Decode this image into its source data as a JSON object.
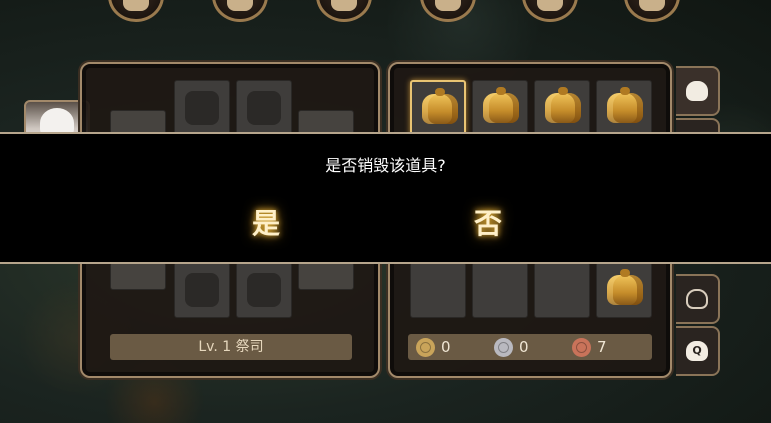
{
  "top_nav": {
    "items": [
      {
        "icon": "scroll-icon"
      },
      {
        "icon": "bag-icon"
      },
      {
        "icon": "crossed-swords-icon"
      },
      {
        "icon": "chest-icon"
      },
      {
        "icon": "map-icon"
      },
      {
        "icon": "gear-icon"
      }
    ]
  },
  "character": {
    "level_label": "Lv. 1 祭司",
    "equipment_slots": [
      {
        "icon": "helmet-icon"
      },
      {
        "icon": "amulet-icon"
      },
      {
        "icon": "gauntlet-icon"
      },
      {
        "icon": "boots-icon"
      }
    ]
  },
  "inventory": {
    "item_name": "gold-bag",
    "selected_index": 0,
    "currency": [
      {
        "icon": "gold-coin-icon",
        "value": "0",
        "color": "#c9a45a"
      },
      {
        "icon": "silver-coin-icon",
        "value": "0",
        "color": "#b9b9c0"
      },
      {
        "icon": "copper-coin-icon",
        "value": "7",
        "color": "#c9735a"
      }
    ],
    "tabs": [
      {
        "icon": "bag-icon",
        "active": true
      },
      {
        "icon": "bag-icon",
        "active": false
      },
      {
        "icon": "bag-icon",
        "active": false
      },
      {
        "icon": "bag-search-icon",
        "glyph": "Q",
        "active": false
      }
    ]
  },
  "dialog": {
    "message": "是否销毁该道具?",
    "yes_label": "是",
    "no_label": "否"
  },
  "colors": {
    "accent_gold": "#e9c473",
    "panel_border": "#a2896a"
  }
}
